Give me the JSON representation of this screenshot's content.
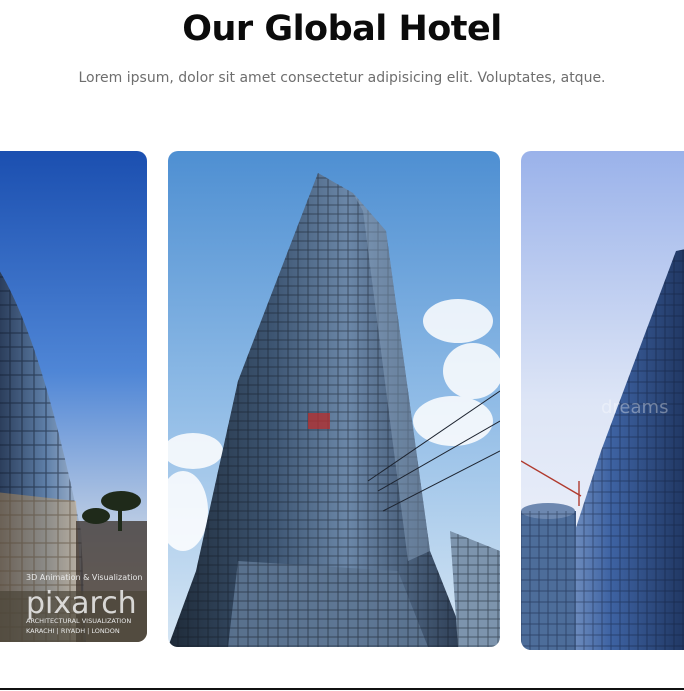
{
  "section": {
    "title": "Our Global Hotel",
    "subtitle": "Lorem ipsum, dolor sit amet consectetur adipisicing elit. Voluptates, atque."
  },
  "carousel": {
    "cards": [
      {
        "watermark_line1": "3D Animation & Visualization",
        "watermark_brand": "pixarch",
        "watermark_line2": "ARCHITECTURAL VISUALIZATION",
        "watermark_line3": "KARACHI | RIYADH | LONDON"
      },
      {},
      {}
    ]
  }
}
